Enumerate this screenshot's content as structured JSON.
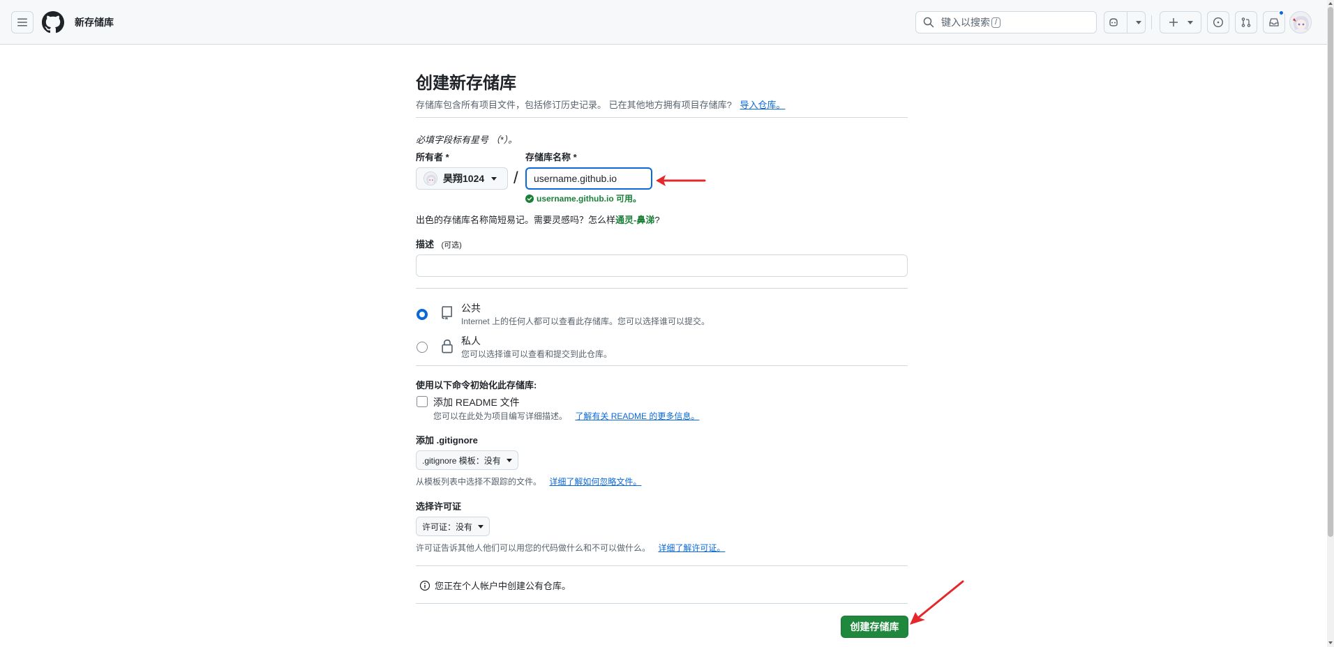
{
  "header": {
    "title": "新存储库",
    "search_placeholder": "键入以搜索",
    "search_key": "/"
  },
  "page": {
    "title": "创建新存储库",
    "subtitle": "存储库包含所有项目文件，包括修订历史记录。 已在其他地方拥有项目存储库?",
    "import_link": "导入仓库。",
    "required_note": "必填字段标有星号 （*）。"
  },
  "owner": {
    "label": "所有者 *",
    "value": "昊翔1024"
  },
  "repo_name": {
    "label": "存储库名称 *",
    "value": "username.github.io",
    "available": "username.github.io 可用。"
  },
  "hint": {
    "prefix": "出色的存储库名称简短易记。需要灵感吗？怎么样",
    "suggestion": "通灵-鼻涕",
    "suffix": "?"
  },
  "description": {
    "label": "描述",
    "optional": "(可选)"
  },
  "visibility": {
    "public_title": "公共",
    "public_desc": "Internet 上的任何人都可以查看此存储库。您可以选择谁可以提交。",
    "private_title": "私人",
    "private_desc": "您可以选择谁可以查看和提交到此仓库。"
  },
  "init": {
    "label": "使用以下命令初始化此存储库:",
    "readme_label": "添加 README 文件",
    "readme_desc": "您可以在此处为项目编写详细描述。",
    "readme_link": "了解有关 README 的更多信息。"
  },
  "gitignore": {
    "label": "添加 .gitignore",
    "select": ".gitignore 模板：没有",
    "desc": "从模板列表中选择不跟踪的文件。",
    "link": "详细了解如何忽略文件。"
  },
  "license": {
    "label": "选择许可证",
    "select": "许可证：没有",
    "desc": "许可证告诉其他人他们可以用您的代码做什么和不可以做什么。",
    "link": "详细了解许可证。"
  },
  "info_note": "您正在个人帐户中创建公有仓库。",
  "create_button": "创建存储库",
  "colors": {
    "accent": "#0969da",
    "success": "#1a7f37",
    "create_button": "#1f883d",
    "annotation_arrow": "#e5262a"
  }
}
